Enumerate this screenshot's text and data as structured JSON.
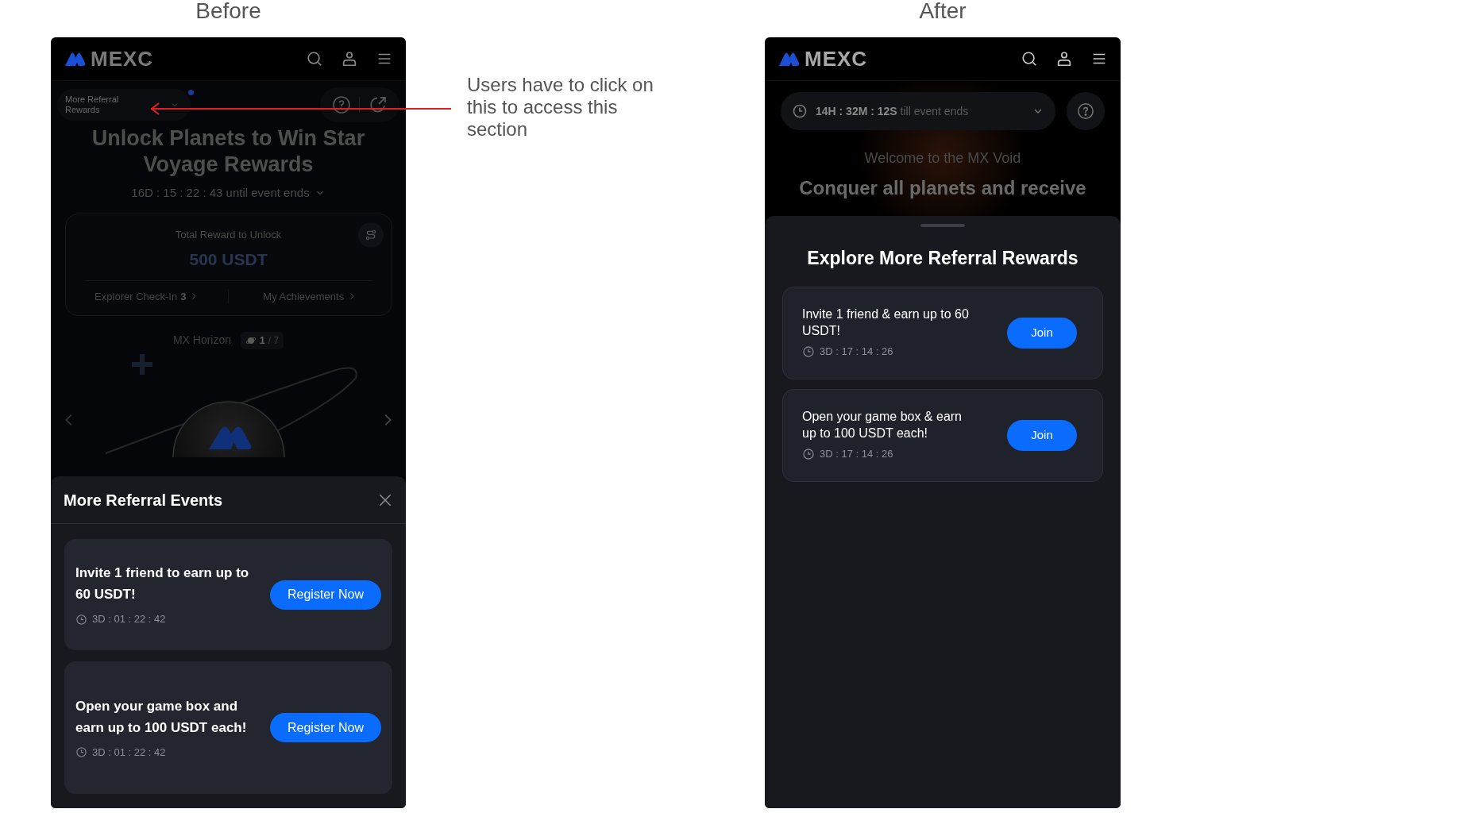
{
  "before": {
    "caption": "Before",
    "brand": "MEXC",
    "referral_dropdown": {
      "label": "More Referral Rewards"
    },
    "title": "Unlock Planets to Win Star Voyage Rewards",
    "countdown": "16D : 15 : 22 : 43 until event ends",
    "reward_card": {
      "label": "Total Reward to Unlock",
      "amount": "500 USDT",
      "links": [
        {
          "label": "Explorer Check-In",
          "count": "3"
        },
        {
          "label": "My Achievements"
        }
      ]
    },
    "planet": {
      "name": "MX Horizon",
      "current": "1",
      "total": "/ 7"
    },
    "sheet": {
      "title": "More Referral Events",
      "events": [
        {
          "title": "Invite 1 friend to earn up to 60 USDT!",
          "timer": "3D : 01 : 22 : 42",
          "button": "Register Now"
        },
        {
          "title": "Open your game box and earn up to 100 USDT each!",
          "timer": "3D : 01 : 22 : 42",
          "button": "Register Now"
        }
      ]
    }
  },
  "annotation": "Users have to click on this to access this section",
  "after": {
    "caption": "After",
    "brand": "MEXC",
    "countdown": {
      "time": "14H : 32M : 12S",
      "suffix": "till event ends"
    },
    "welcome": "Welcome to the MX Void",
    "headline": "Conquer all planets and receive",
    "sheet": {
      "title": "Explore More Referral Rewards",
      "events": [
        {
          "title": "Invite 1 friend & earn up to 60 USDT!",
          "timer": "3D : 17 : 14 : 26",
          "button": "Join"
        },
        {
          "title": "Open your game box & earn up to 100 USDT each!",
          "timer": "3D : 17 : 14 : 26",
          "button": "Join"
        }
      ]
    }
  }
}
